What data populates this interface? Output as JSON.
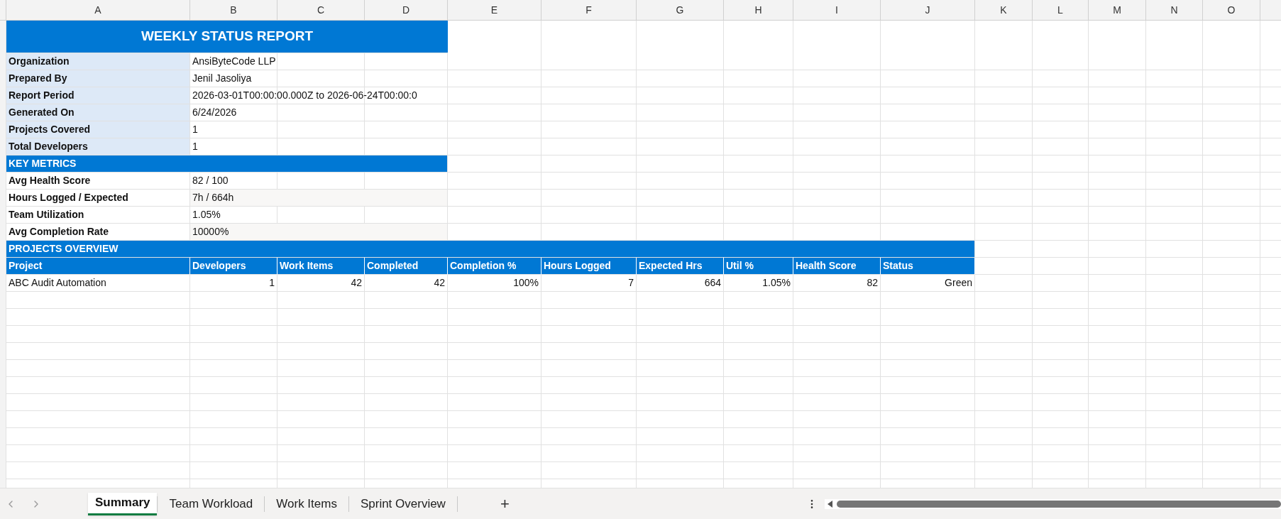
{
  "column_headers": [
    "A",
    "B",
    "C",
    "D",
    "E",
    "F",
    "G",
    "H",
    "I",
    "J",
    "K",
    "L",
    "M",
    "N",
    "O"
  ],
  "title": "WEEKLY STATUS REPORT",
  "info": [
    {
      "label": "Organization",
      "value": "AnsiByteCode LLP"
    },
    {
      "label": "Prepared By",
      "value": "Jenil Jasoliya"
    },
    {
      "label": "Report Period",
      "value": "2026-03-01T00:00:00.000Z to 2026-06-24T00:00:0"
    },
    {
      "label": "Generated On",
      "value": "6/24/2026"
    },
    {
      "label": "Projects Covered",
      "value": "1"
    },
    {
      "label": "Total Developers",
      "value": "1"
    }
  ],
  "key_metrics": {
    "heading": "KEY METRICS",
    "rows": [
      {
        "label": "Avg Health Score",
        "value": "82 / 100"
      },
      {
        "label": "Hours Logged / Expected",
        "value": "7h / 664h"
      },
      {
        "label": "Team Utilization",
        "value": "1.05%"
      },
      {
        "label": "Avg Completion Rate",
        "value": "10000%"
      }
    ]
  },
  "projects_overview": {
    "heading": "PROJECTS OVERVIEW",
    "columns": [
      "Project",
      "Developers",
      "Work Items",
      "Completed",
      "Completion %",
      "Hours Logged",
      "Expected Hrs",
      "Util %",
      "Health Score",
      "Status"
    ],
    "rows": [
      [
        "ABC Audit Automation",
        "1",
        "42",
        "42",
        "100%",
        "7",
        "664",
        "1.05%",
        "82",
        "Green"
      ]
    ]
  },
  "sheet_tabs": [
    {
      "label": "Summary",
      "selected": true
    },
    {
      "label": "Team Workload",
      "selected": false
    },
    {
      "label": "Work Items",
      "selected": false
    },
    {
      "label": "Sprint Overview",
      "selected": false
    }
  ],
  "add_sheet": "+"
}
